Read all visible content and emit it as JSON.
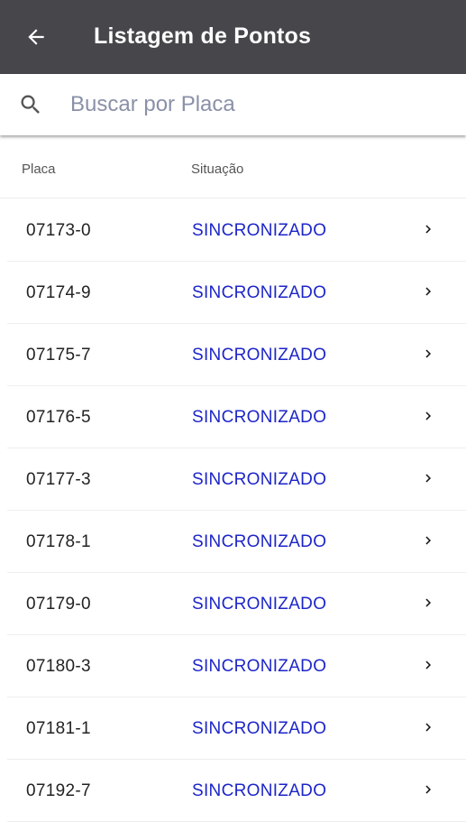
{
  "app_bar": {
    "title": "Listagem de Pontos",
    "back_icon": "arrow-left-icon"
  },
  "search": {
    "placeholder": "Buscar por Placa",
    "value": "",
    "icon": "search-icon"
  },
  "table": {
    "headers": {
      "placa": "Placa",
      "situacao": "Situação"
    },
    "rows": [
      {
        "placa": "07173-0",
        "situacao": "SINCRONIZADO"
      },
      {
        "placa": "07174-9",
        "situacao": "SINCRONIZADO"
      },
      {
        "placa": "07175-7",
        "situacao": "SINCRONIZADO"
      },
      {
        "placa": "07176-5",
        "situacao": "SINCRONIZADO"
      },
      {
        "placa": "07177-3",
        "situacao": "SINCRONIZADO"
      },
      {
        "placa": "07178-1",
        "situacao": "SINCRONIZADO"
      },
      {
        "placa": "07179-0",
        "situacao": "SINCRONIZADO"
      },
      {
        "placa": "07180-3",
        "situacao": "SINCRONIZADO"
      },
      {
        "placa": "07181-1",
        "situacao": "SINCRONIZADO"
      },
      {
        "placa": "07192-7",
        "situacao": "SINCRONIZADO"
      }
    ]
  },
  "colors": {
    "app_bar": "#47464b",
    "status": "#1d25c9"
  }
}
